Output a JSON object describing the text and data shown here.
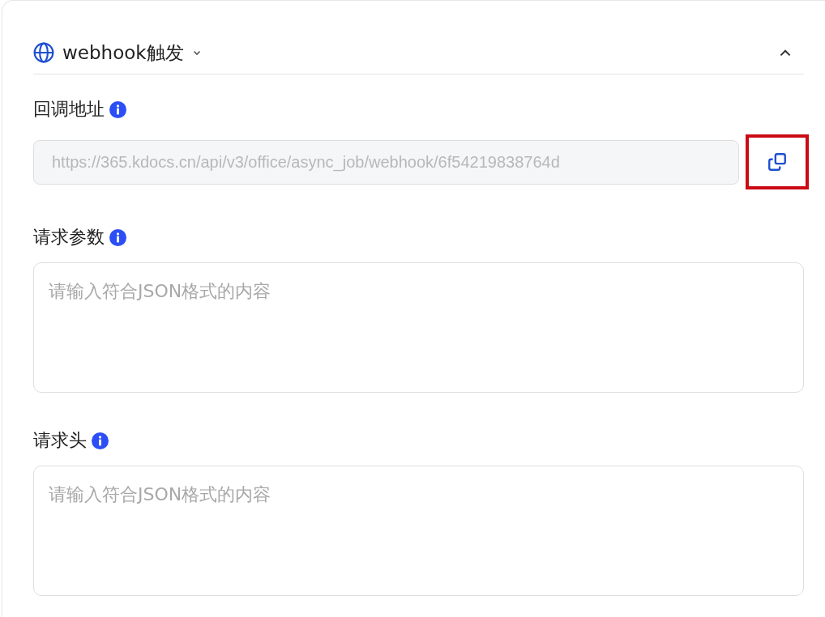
{
  "trigger": {
    "label": "webhook触发",
    "expanded": true
  },
  "fields": [
    {
      "kind": "url",
      "label": "回调地址",
      "value": "https://365.kdocs.cn/api/v3/office/async_job/webhook/6f54219838764d",
      "disabled": true,
      "copy_highlighted": true
    },
    {
      "kind": "textarea",
      "label": "请求参数",
      "placeholder": "请输入符合JSON格式的内容"
    },
    {
      "kind": "textarea",
      "label": "请求头",
      "placeholder": "请输入符合JSON格式的内容"
    }
  ]
}
